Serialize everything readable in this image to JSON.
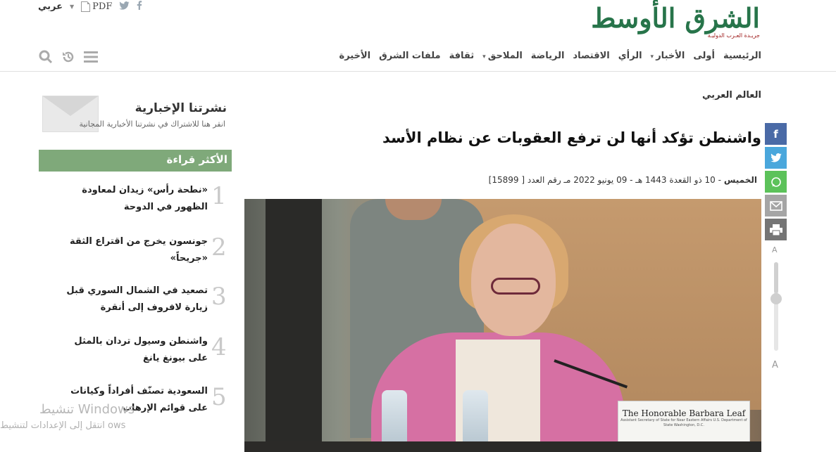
{
  "logo": {
    "text": "الشرق الأوسط",
    "subtitle": "جريـدة العـرب الدوليـة"
  },
  "utility": {
    "language": "عربي",
    "pdf_label": "PDF"
  },
  "nav": {
    "items": [
      {
        "label": "الرئيسية",
        "dropdown": false
      },
      {
        "label": "أولى",
        "dropdown": false
      },
      {
        "label": "الأخبار",
        "dropdown": true
      },
      {
        "label": "الرأي",
        "dropdown": false
      },
      {
        "label": "الاقتصاد",
        "dropdown": false
      },
      {
        "label": "الرياضة",
        "dropdown": false
      },
      {
        "label": "الملاحق",
        "dropdown": true
      },
      {
        "label": "ثقافة",
        "dropdown": false
      },
      {
        "label": "ملفات الشرق",
        "dropdown": false
      },
      {
        "label": "الأخيرة",
        "dropdown": false
      }
    ]
  },
  "article": {
    "category": "العالم العربي",
    "headline": "واشنطن تؤكد أنها لن ترفع العقوبات عن نظام الأسد",
    "day": "الخميس",
    "date_text": "- 10 ذو القعدة 1443 هـ - 09 يونيو 2022 مـ رقم العدد [ 15899]",
    "photo_caption_sign": "The Honorable Barbara Leaf",
    "photo_sign_sub": "Assistant Secretary of State for Near Eastern Affairs U.S. Department of State Washington, D.C."
  },
  "share": {
    "font_small": "A",
    "font_large": "A",
    "font_size_level": 0.4
  },
  "sidebar": {
    "newsletter_title": "نشرتنا الإخبارية",
    "newsletter_sub": "انقر هنا للاشتراك في نشرتنا الأخبارية المجانية",
    "most_read_title": "الأكثر قراءة",
    "most_read": [
      {
        "num": "1",
        "text": "«نطحة رأس» زيدان لمعاودة الظهور في الدوحة"
      },
      {
        "num": "2",
        "text": "جونسون يخرج من اقتراع الثقة «جريحاً»"
      },
      {
        "num": "3",
        "text": "تصعيد في الشمال السوري قبل زيارة لافروف إلى أنقرة"
      },
      {
        "num": "4",
        "text": "واشنطن وسيول تردان بالمثل على بيونغ يانغ"
      },
      {
        "num": "5",
        "text": "السعودية تصنّف أفراداً وكيانات على قوائم الإرهاب"
      }
    ]
  },
  "watermark": {
    "line1": "تنشيط Windows",
    "line2": "انتقل إلى الإعدادات لتنشيط ows"
  }
}
